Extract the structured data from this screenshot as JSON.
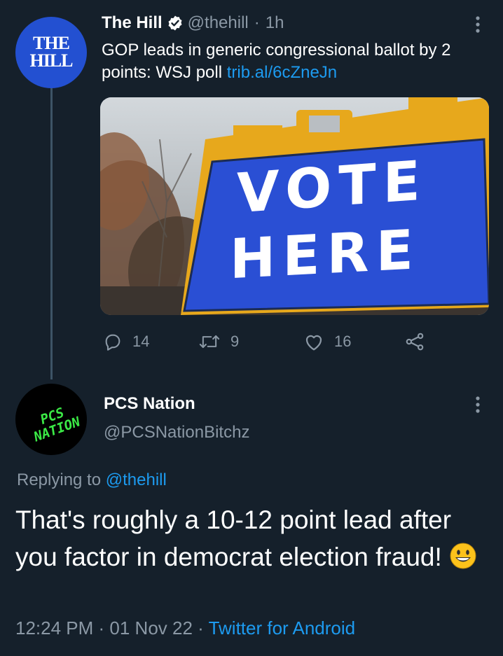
{
  "tweet1": {
    "author_name": "The Hill",
    "handle": "@thehill",
    "separator": "·",
    "time": "1h",
    "avatar_text_line1": "THE",
    "avatar_text_line2": "HILL",
    "text": "GOP leads in generic congressional ballot by 2 points: WSJ poll",
    "link": "trib.al/6cZneJn",
    "media": {
      "sign_line1": "VOTE",
      "sign_line2": "HERE"
    },
    "actions": {
      "replies": "14",
      "retweets": "9",
      "likes": "16"
    }
  },
  "tweet2": {
    "author_name": "PCS Nation",
    "handle": "@PCSNationBitchz",
    "avatar_text_line1": "PCS",
    "avatar_text_line2": "NATION",
    "replying_label": "Replying to",
    "replying_handle": "@thehill",
    "text": "That's roughly a 10-12 point lead after you factor in democrat election fraud!",
    "timestamp": "12:24 PM · 01 Nov 22 ·",
    "client": "Twitter for Android"
  },
  "colors": {
    "background": "#15202b",
    "accent": "#1d9bf0",
    "muted": "#8b98a5",
    "hill_blue": "#2350d1",
    "pcs_green": "#3bea46"
  },
  "icons": [
    "verified-badge-icon",
    "more-options-icon",
    "reply-icon",
    "retweet-icon",
    "like-icon",
    "share-icon",
    "grinning-face-emoji"
  ]
}
